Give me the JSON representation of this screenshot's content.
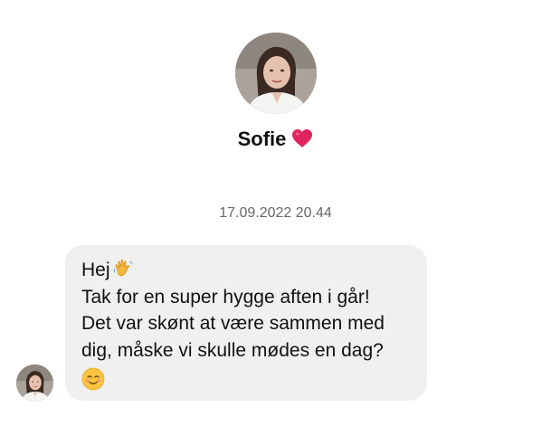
{
  "contact": {
    "name": "Sofie",
    "name_emoji": "heart-emoji"
  },
  "timestamp": "17.09.2022 20.44",
  "message": {
    "lines": [
      "Hej",
      "Tak for en super hygge aften i går!",
      "Det var skønt at være sammen med",
      "dig, måske vi skulle mødes en dag?"
    ],
    "emojis": [
      "waving-hand-emoji",
      "smiling-face-with-smiling-eyes-emoji"
    ]
  },
  "colors": {
    "bubble": "#f0f0f0",
    "timestamp": "#65676b",
    "heart": "#e0245e"
  }
}
